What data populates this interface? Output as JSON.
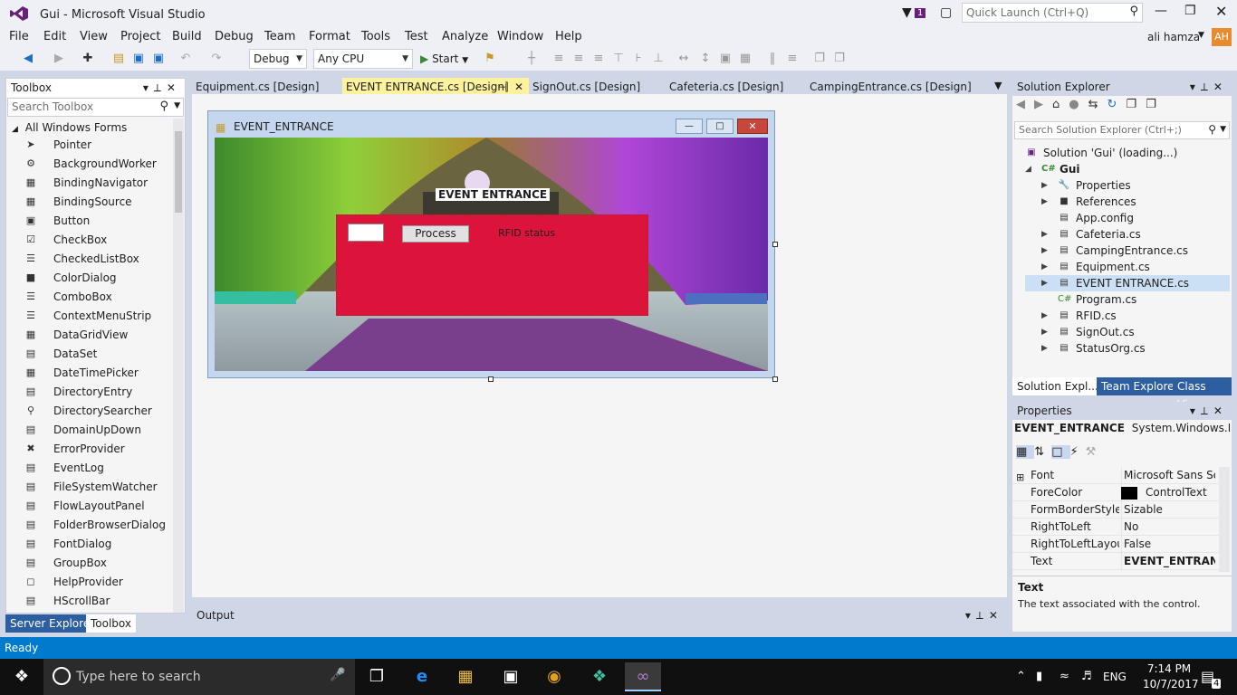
{
  "titlebar": {
    "title": "Gui - Microsoft Visual Studio",
    "notif_count": "1",
    "quick_launch": "Quick Launch (Ctrl+Q)",
    "user": "ali hamza",
    "avatar": "AH"
  },
  "menu": [
    "File",
    "Edit",
    "View",
    "Project",
    "Build",
    "Debug",
    "Team",
    "Format",
    "Tools",
    "Test",
    "Analyze",
    "Window",
    "Help"
  ],
  "toolbar": {
    "config": "Debug",
    "platform": "Any CPU",
    "start": "Start"
  },
  "toolbox": {
    "title": "Toolbox",
    "search": "Search Toolbox",
    "group": "All Windows Forms",
    "items": [
      "Pointer",
      "BackgroundWorker",
      "BindingNavigator",
      "BindingSource",
      "Button",
      "CheckBox",
      "CheckedListBox",
      "ColorDialog",
      "ComboBox",
      "ContextMenuStrip",
      "DataGridView",
      "DataSet",
      "DateTimePicker",
      "DirectoryEntry",
      "DirectorySearcher",
      "DomainUpDown",
      "ErrorProvider",
      "EventLog",
      "FileSystemWatcher",
      "FlowLayoutPanel",
      "FolderBrowserDialog",
      "FontDialog",
      "GroupBox",
      "HelpProvider",
      "HScrollBar"
    ],
    "bottom_tabs": [
      "Server Explorer",
      "Toolbox"
    ]
  },
  "tabs": [
    "Equipment.cs [Design]",
    "EVENT ENTRANCE.cs [Design]",
    "SignOut.cs [Design]",
    "Cafeteria.cs [Design]",
    "CampingEntrance.cs [Design]"
  ],
  "form": {
    "title": "EVENT_ENTRANCE",
    "banner": "EVENT ENTRANCE",
    "button": "Process",
    "label": "RFID  status"
  },
  "solution": {
    "title": "Solution Explorer",
    "search": "Search Solution Explorer (Ctrl+;)",
    "root": "Solution 'Gui' (loading...)",
    "project": "Gui",
    "items": [
      "Properties",
      "References",
      "App.config",
      "Cafeteria.cs",
      "CampingEntrance.cs",
      "Equipment.cs",
      "EVENT ENTRANCE.cs",
      "Program.cs",
      "RFID.cs",
      "SignOut.cs",
      "StatusOrg.cs"
    ],
    "bottom_tabs": [
      "Solution Expl...",
      "Team Explorer",
      "Class View"
    ]
  },
  "properties": {
    "title": "Properties",
    "object": "EVENT_ENTRANCE",
    "type": "System.Windows.Forms.Form",
    "rows": [
      {
        "name": "Font",
        "value": "Microsoft Sans Serif"
      },
      {
        "name": "ForeColor",
        "value": "ControlText"
      },
      {
        "name": "FormBorderStyle",
        "value": "Sizable"
      },
      {
        "name": "RightToLeft",
        "value": "No"
      },
      {
        "name": "RightToLeftLayout",
        "value": "False"
      },
      {
        "name": "Text",
        "value": "EVENT_ENTRANCE"
      }
    ],
    "desc_title": "Text",
    "desc": "The text associated with the control."
  },
  "output": {
    "title": "Output"
  },
  "status": "Ready",
  "taskbar": {
    "search": "Type here to search",
    "lang": "ENG",
    "time": "7:14 PM",
    "date": "10/7/2017",
    "notif": "4"
  },
  "colors": {
    "accent": "#007acc",
    "form_panel": "#dc143c",
    "active_tab": "#fff29d"
  }
}
